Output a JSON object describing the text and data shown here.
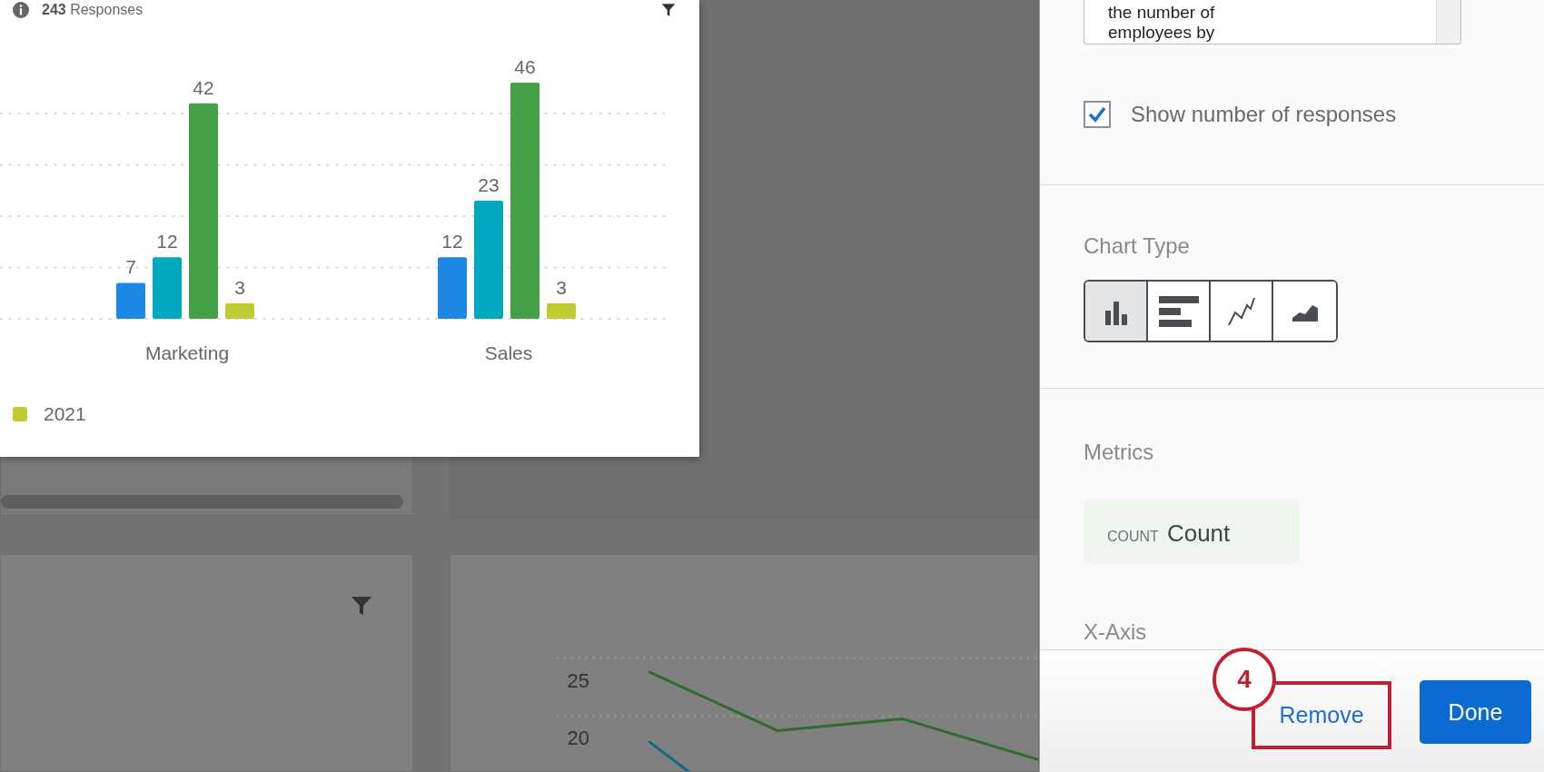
{
  "widget": {
    "response_count": "**243** Responses",
    "chart_data": {
      "type": "bar",
      "categories": [
        "Marketing",
        "Sales"
      ],
      "data_labels": true,
      "series": [
        {
          "color": "#1e88e5",
          "values": [
            7,
            12
          ]
        },
        {
          "color": "#00a9c0",
          "values": [
            12,
            23
          ]
        },
        {
          "color": "#43a047",
          "values": [
            42,
            46
          ]
        },
        {
          "name": "2021",
          "color": "#c0ca33",
          "values": [
            3,
            3
          ]
        }
      ]
    }
  },
  "line_widget": {
    "axis_labels": [
      "25",
      "20"
    ]
  },
  "panel": {
    "description": "the number of\nemployees by",
    "show_responses": {
      "label": "Show number of responses",
      "checked": true
    },
    "chart_type": {
      "label": "Chart Type",
      "options": [
        {
          "kind": "bar",
          "selected": true
        },
        {
          "kind": "horizontal_bar",
          "selected": false
        },
        {
          "kind": "line",
          "selected": false
        },
        {
          "kind": "area",
          "selected": false
        }
      ]
    },
    "metrics": {
      "label": "Metrics",
      "chips": [
        {
          "tag": "COUNT",
          "label": "Count"
        }
      ]
    },
    "x_axis": {
      "label": "X-Axis"
    }
  },
  "footer": {
    "buttons": [
      {
        "label": "Remove",
        "kind": "link"
      },
      {
        "label": "Done",
        "kind": "primary"
      }
    ]
  },
  "callout": {
    "number": "4"
  }
}
